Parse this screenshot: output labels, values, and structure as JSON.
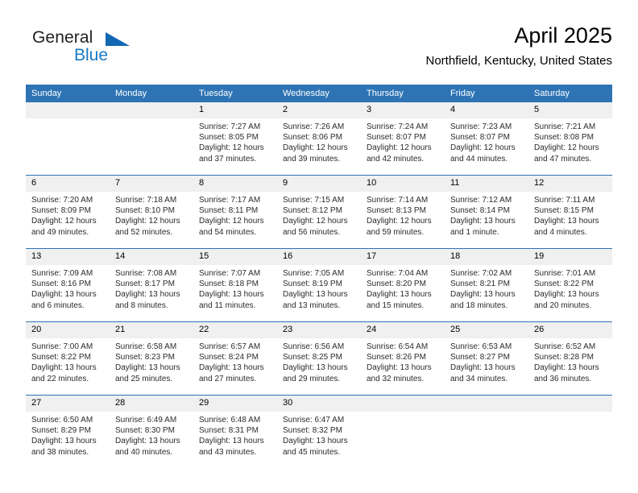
{
  "brand": {
    "name_dark": "General",
    "name_blue": "Blue",
    "accent_color": "#1268b3"
  },
  "header": {
    "title": "April 2025",
    "subtitle": "Northfield, Kentucky, United States"
  },
  "theme": {
    "header_blue": "#2e74b5",
    "daynum_band": "#f0f0f0"
  },
  "weekday_headers": [
    "Sunday",
    "Monday",
    "Tuesday",
    "Wednesday",
    "Thursday",
    "Friday",
    "Saturday"
  ],
  "labels": {
    "sunrise_prefix": "Sunrise:",
    "sunset_prefix": "Sunset:",
    "daylight_prefix": "Daylight:"
  },
  "weeks": [
    [
      {
        "day": "",
        "empty": true
      },
      {
        "day": "",
        "empty": true
      },
      {
        "day": "1",
        "sunrise": "Sunrise: 7:27 AM",
        "sunset": "Sunset: 8:05 PM",
        "daylight1": "Daylight: 12 hours",
        "daylight2": "and 37 minutes."
      },
      {
        "day": "2",
        "sunrise": "Sunrise: 7:26 AM",
        "sunset": "Sunset: 8:06 PM",
        "daylight1": "Daylight: 12 hours",
        "daylight2": "and 39 minutes."
      },
      {
        "day": "3",
        "sunrise": "Sunrise: 7:24 AM",
        "sunset": "Sunset: 8:07 PM",
        "daylight1": "Daylight: 12 hours",
        "daylight2": "and 42 minutes."
      },
      {
        "day": "4",
        "sunrise": "Sunrise: 7:23 AM",
        "sunset": "Sunset: 8:07 PM",
        "daylight1": "Daylight: 12 hours",
        "daylight2": "and 44 minutes."
      },
      {
        "day": "5",
        "sunrise": "Sunrise: 7:21 AM",
        "sunset": "Sunset: 8:08 PM",
        "daylight1": "Daylight: 12 hours",
        "daylight2": "and 47 minutes."
      }
    ],
    [
      {
        "day": "6",
        "sunrise": "Sunrise: 7:20 AM",
        "sunset": "Sunset: 8:09 PM",
        "daylight1": "Daylight: 12 hours",
        "daylight2": "and 49 minutes."
      },
      {
        "day": "7",
        "sunrise": "Sunrise: 7:18 AM",
        "sunset": "Sunset: 8:10 PM",
        "daylight1": "Daylight: 12 hours",
        "daylight2": "and 52 minutes."
      },
      {
        "day": "8",
        "sunrise": "Sunrise: 7:17 AM",
        "sunset": "Sunset: 8:11 PM",
        "daylight1": "Daylight: 12 hours",
        "daylight2": "and 54 minutes."
      },
      {
        "day": "9",
        "sunrise": "Sunrise: 7:15 AM",
        "sunset": "Sunset: 8:12 PM",
        "daylight1": "Daylight: 12 hours",
        "daylight2": "and 56 minutes."
      },
      {
        "day": "10",
        "sunrise": "Sunrise: 7:14 AM",
        "sunset": "Sunset: 8:13 PM",
        "daylight1": "Daylight: 12 hours",
        "daylight2": "and 59 minutes."
      },
      {
        "day": "11",
        "sunrise": "Sunrise: 7:12 AM",
        "sunset": "Sunset: 8:14 PM",
        "daylight1": "Daylight: 13 hours",
        "daylight2": "and 1 minute."
      },
      {
        "day": "12",
        "sunrise": "Sunrise: 7:11 AM",
        "sunset": "Sunset: 8:15 PM",
        "daylight1": "Daylight: 13 hours",
        "daylight2": "and 4 minutes."
      }
    ],
    [
      {
        "day": "13",
        "sunrise": "Sunrise: 7:09 AM",
        "sunset": "Sunset: 8:16 PM",
        "daylight1": "Daylight: 13 hours",
        "daylight2": "and 6 minutes."
      },
      {
        "day": "14",
        "sunrise": "Sunrise: 7:08 AM",
        "sunset": "Sunset: 8:17 PM",
        "daylight1": "Daylight: 13 hours",
        "daylight2": "and 8 minutes."
      },
      {
        "day": "15",
        "sunrise": "Sunrise: 7:07 AM",
        "sunset": "Sunset: 8:18 PM",
        "daylight1": "Daylight: 13 hours",
        "daylight2": "and 11 minutes."
      },
      {
        "day": "16",
        "sunrise": "Sunrise: 7:05 AM",
        "sunset": "Sunset: 8:19 PM",
        "daylight1": "Daylight: 13 hours",
        "daylight2": "and 13 minutes."
      },
      {
        "day": "17",
        "sunrise": "Sunrise: 7:04 AM",
        "sunset": "Sunset: 8:20 PM",
        "daylight1": "Daylight: 13 hours",
        "daylight2": "and 15 minutes."
      },
      {
        "day": "18",
        "sunrise": "Sunrise: 7:02 AM",
        "sunset": "Sunset: 8:21 PM",
        "daylight1": "Daylight: 13 hours",
        "daylight2": "and 18 minutes."
      },
      {
        "day": "19",
        "sunrise": "Sunrise: 7:01 AM",
        "sunset": "Sunset: 8:22 PM",
        "daylight1": "Daylight: 13 hours",
        "daylight2": "and 20 minutes."
      }
    ],
    [
      {
        "day": "20",
        "sunrise": "Sunrise: 7:00 AM",
        "sunset": "Sunset: 8:22 PM",
        "daylight1": "Daylight: 13 hours",
        "daylight2": "and 22 minutes."
      },
      {
        "day": "21",
        "sunrise": "Sunrise: 6:58 AM",
        "sunset": "Sunset: 8:23 PM",
        "daylight1": "Daylight: 13 hours",
        "daylight2": "and 25 minutes."
      },
      {
        "day": "22",
        "sunrise": "Sunrise: 6:57 AM",
        "sunset": "Sunset: 8:24 PM",
        "daylight1": "Daylight: 13 hours",
        "daylight2": "and 27 minutes."
      },
      {
        "day": "23",
        "sunrise": "Sunrise: 6:56 AM",
        "sunset": "Sunset: 8:25 PM",
        "daylight1": "Daylight: 13 hours",
        "daylight2": "and 29 minutes."
      },
      {
        "day": "24",
        "sunrise": "Sunrise: 6:54 AM",
        "sunset": "Sunset: 8:26 PM",
        "daylight1": "Daylight: 13 hours",
        "daylight2": "and 32 minutes."
      },
      {
        "day": "25",
        "sunrise": "Sunrise: 6:53 AM",
        "sunset": "Sunset: 8:27 PM",
        "daylight1": "Daylight: 13 hours",
        "daylight2": "and 34 minutes."
      },
      {
        "day": "26",
        "sunrise": "Sunrise: 6:52 AM",
        "sunset": "Sunset: 8:28 PM",
        "daylight1": "Daylight: 13 hours",
        "daylight2": "and 36 minutes."
      }
    ],
    [
      {
        "day": "27",
        "sunrise": "Sunrise: 6:50 AM",
        "sunset": "Sunset: 8:29 PM",
        "daylight1": "Daylight: 13 hours",
        "daylight2": "and 38 minutes."
      },
      {
        "day": "28",
        "sunrise": "Sunrise: 6:49 AM",
        "sunset": "Sunset: 8:30 PM",
        "daylight1": "Daylight: 13 hours",
        "daylight2": "and 40 minutes."
      },
      {
        "day": "29",
        "sunrise": "Sunrise: 6:48 AM",
        "sunset": "Sunset: 8:31 PM",
        "daylight1": "Daylight: 13 hours",
        "daylight2": "and 43 minutes."
      },
      {
        "day": "30",
        "sunrise": "Sunrise: 6:47 AM",
        "sunset": "Sunset: 8:32 PM",
        "daylight1": "Daylight: 13 hours",
        "daylight2": "and 45 minutes."
      },
      {
        "day": "",
        "empty": true
      },
      {
        "day": "",
        "empty": true
      },
      {
        "day": "",
        "empty": true
      }
    ]
  ]
}
